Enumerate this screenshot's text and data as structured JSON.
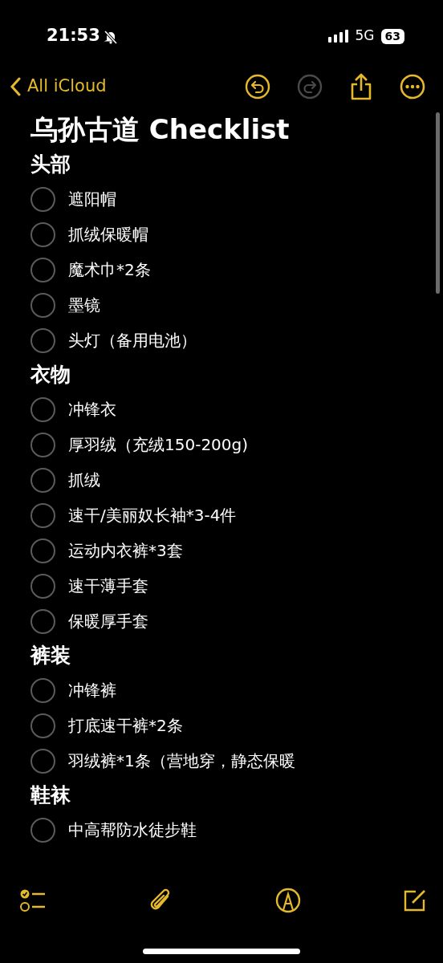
{
  "status_bar": {
    "time": "21:53",
    "silenced": true,
    "network": "5G",
    "battery": "63"
  },
  "nav": {
    "back_label": "All iCloud",
    "undo": {
      "disabled": false
    },
    "redo": {
      "disabled": true
    }
  },
  "note": {
    "title": "乌孙古道 Checklist",
    "sections": [
      {
        "heading": "头部",
        "items": [
          {
            "text": "遮阳帽",
            "checked": false
          },
          {
            "text": "抓绒保暖帽",
            "checked": false
          },
          {
            "text": "魔术巾*2条",
            "checked": false
          },
          {
            "text": "墨镜",
            "checked": false
          },
          {
            "text": "头灯（备用电池）",
            "checked": false
          }
        ]
      },
      {
        "heading": "衣物",
        "items": [
          {
            "text": "冲锋衣",
            "checked": false
          },
          {
            "text": "厚羽绒（充绒150-200g)",
            "checked": false
          },
          {
            "text": "抓绒",
            "checked": false
          },
          {
            "text": "速干/美丽奴长袖*3-4件",
            "checked": false
          },
          {
            "text": "运动内衣裤*3套",
            "checked": false
          },
          {
            "text": "速干薄手套",
            "checked": false
          },
          {
            "text": "保暖厚手套",
            "checked": false
          }
        ]
      },
      {
        "heading": "裤装",
        "items": [
          {
            "text": "冲锋裤",
            "checked": false
          },
          {
            "text": "打底速干裤*2条",
            "checked": false
          },
          {
            "text": "羽绒裤*1条（营地穿，静态保暖",
            "checked": false
          }
        ]
      },
      {
        "heading": "鞋袜",
        "items": [
          {
            "text": "中高帮防水徒步鞋",
            "checked": false
          }
        ]
      }
    ]
  }
}
